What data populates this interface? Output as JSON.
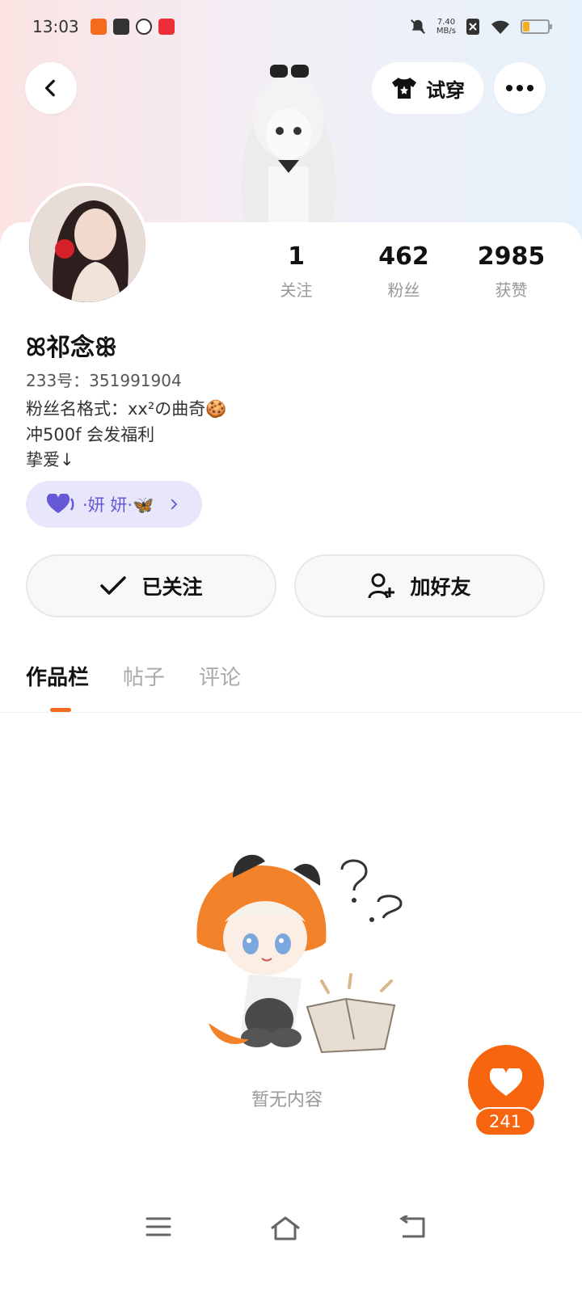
{
  "status_bar": {
    "time": "13:03",
    "notifications": [
      {
        "icon": "game233-icon",
        "color": "#f56a1c"
      },
      {
        "icon": "mail-icon",
        "color": "#333333"
      },
      {
        "icon": "play-icon",
        "color": "#333333"
      },
      {
        "icon": "xiaohongshu-icon",
        "color": "#ee2d3a"
      }
    ],
    "net_speed_value": "7.40",
    "net_speed_unit": "MB/s",
    "battery_level": 0.25
  },
  "top_bar": {
    "back_icon": "chevron-left-icon",
    "try_on_label": "试穿",
    "try_on_icon": "tshirt-icon",
    "more_icon": "more-icon"
  },
  "profile": {
    "stats": [
      {
        "value": "1",
        "label": "关注"
      },
      {
        "value": "462",
        "label": "粉丝"
      },
      {
        "value": "2985",
        "label": "获赞"
      }
    ],
    "nickname": "ꕤ祁念ꕥ",
    "uid": "233号：351991904",
    "bio": [
      "粉丝名格式：xx²の曲奇🍪",
      "冲500f 会发福利",
      "挚爱↓"
    ],
    "fan_badge": {
      "label": "·妍 妍·🦋",
      "color": "#6559d6"
    }
  },
  "actions": {
    "following_label": "已关注",
    "add_friend_label": "加好友"
  },
  "tabs": [
    {
      "label": "作品栏",
      "active": true
    },
    {
      "label": "帖子",
      "active": false
    },
    {
      "label": "评论",
      "active": false
    }
  ],
  "empty_state": {
    "text": "暂无内容"
  },
  "fab": {
    "icon": "heart-icon",
    "count": "241",
    "color": "#f8650f"
  },
  "nav": {
    "menu_icon": "menu-icon",
    "home_icon": "home-icon",
    "back_icon": "back-icon"
  }
}
